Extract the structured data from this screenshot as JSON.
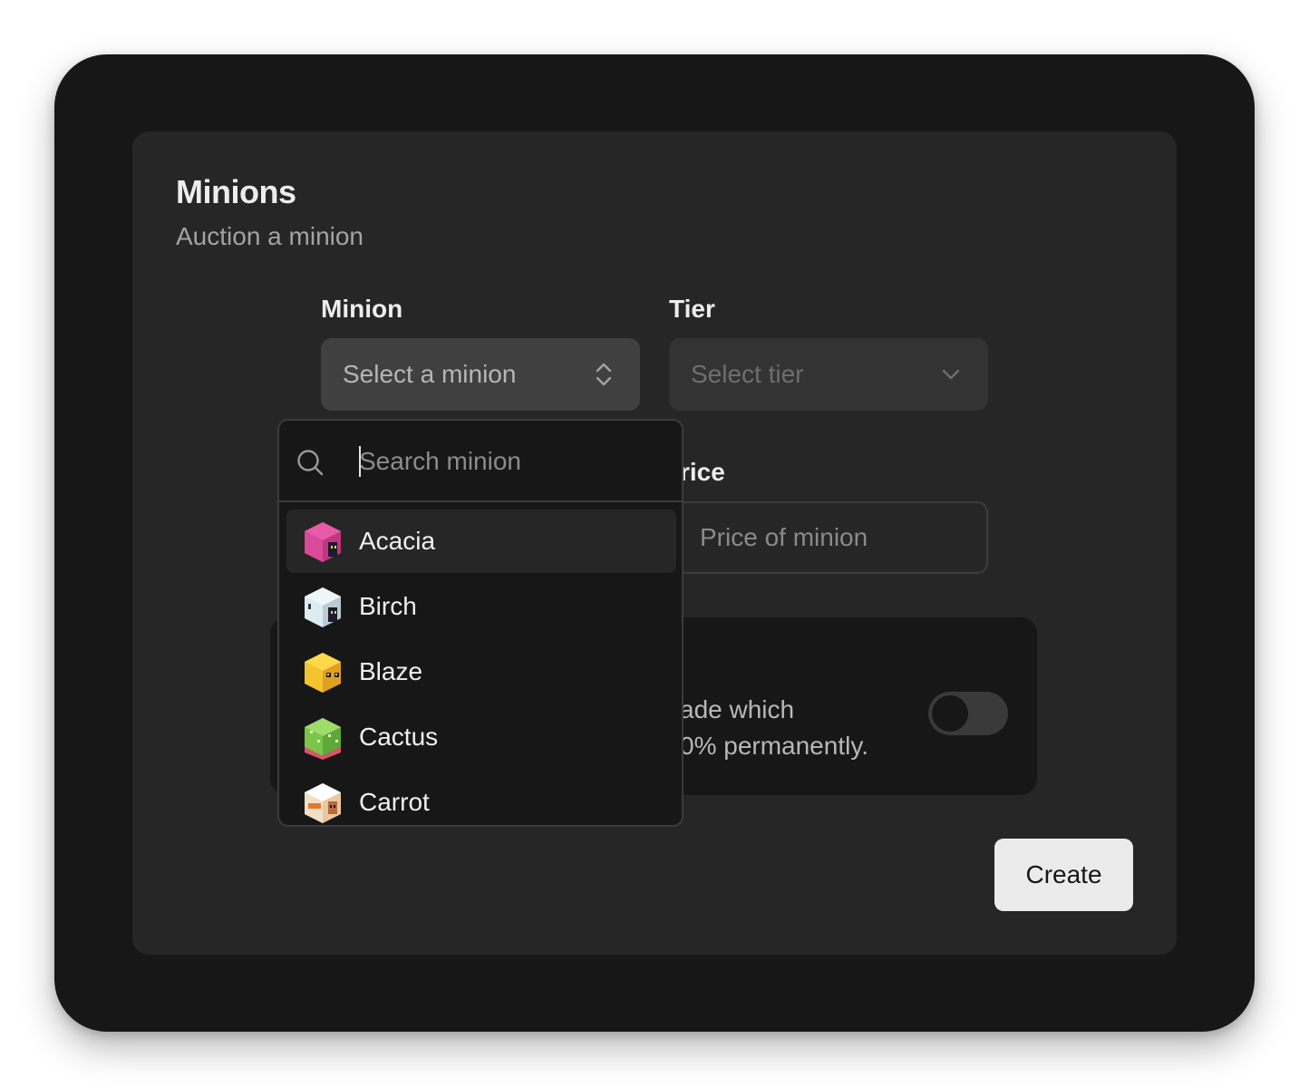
{
  "card": {
    "title": "Minions",
    "subtitle": "Auction a minion"
  },
  "form": {
    "minion_label": "Minion",
    "minion_placeholder": "Select a minion",
    "tier_label": "Tier",
    "tier_placeholder": "Select tier",
    "price_label_visible": "rice",
    "price_placeholder": "Price of minion",
    "toggle_desc_line1": "ade which",
    "toggle_desc_line2": "0% permanently.",
    "toggle_on": false,
    "create_label": "Create"
  },
  "dropdown": {
    "search_placeholder": "Search minion",
    "options": [
      {
        "label": "Acacia",
        "icon": "acacia-minion-icon",
        "color": "#d94a9a",
        "active": true
      },
      {
        "label": "Birch",
        "icon": "birch-minion-icon",
        "color": "#dcecf0",
        "active": false
      },
      {
        "label": "Blaze",
        "icon": "blaze-minion-icon",
        "color": "#f4c430",
        "active": false
      },
      {
        "label": "Cactus",
        "icon": "cactus-minion-icon",
        "color": "#7cc44a",
        "active": false
      },
      {
        "label": "Carrot",
        "icon": "carrot-minion-icon",
        "color": "#f0e0c8",
        "active": false
      }
    ]
  }
}
